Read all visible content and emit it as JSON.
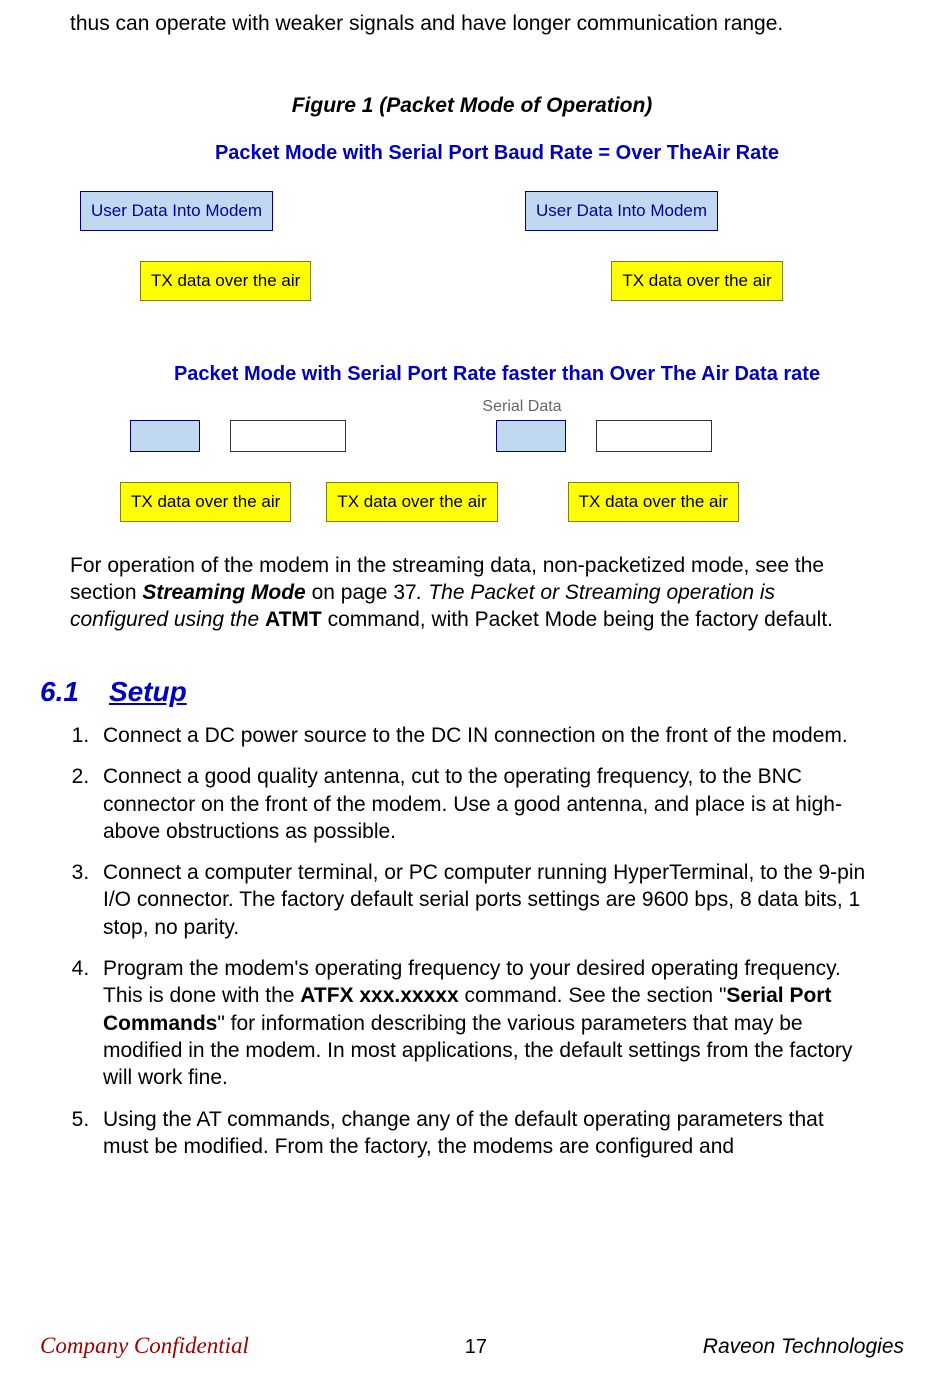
{
  "intro_text": "thus can operate with weaker signals and have longer communication range.",
  "figure": {
    "caption": "Figure 1 (Packet Mode of Operation)",
    "title1": "Packet Mode with Serial Port Baud Rate  =  Over TheAir Rate",
    "user_data_label": "User Data Into Modem",
    "tx_label": "TX data over the air",
    "title2": "Packet Mode with Serial Port Rate faster than Over The Air Data rate",
    "serial_data_label": "Serial Data"
  },
  "after_figure": {
    "prefix": "For operation of the modem in the streaming data, non-packetized mode, see the section ",
    "streaming_mode": "Streaming Mode",
    "mid1": " on page 37",
    "mid2": ".   The Packet or Streaming operation is configured using the ",
    "atmt": "ATMT",
    "suffix": " command, with Packet Mode being the factory default."
  },
  "section": {
    "num": "6.1",
    "title": "Setup"
  },
  "list": {
    "item1": "Connect a DC power source to the DC IN connection on the front of the modem.",
    "item2": "Connect a good quality antenna, cut to the operating frequency, to the BNC connector on the front of the modem.  Use a good antenna, and place is at high-above obstructions as possible.",
    "item3": "Connect a computer terminal, or PC computer running HyperTerminal, to the 9-pin I/O connector.  The factory default serial ports settings are 9600 bps, 8 data bits, 1 stop, no parity.",
    "item4_p1": "Program the modem's operating frequency to your desired operating frequency.  This is done with the ",
    "item4_cmd": "ATFX xxx.xxxxx",
    "item4_p2": " command. See the section \"",
    "item4_section": "Serial Port Commands",
    "item4_p3": "\" for information describing the various parameters that may be modified in the modem.  In most applications, the default settings from the factory will work fine.",
    "item5": "Using the AT commands, change any of the default operating parameters that must be modified.  From the factory, the modems are configured and"
  },
  "footer": {
    "left": "Company Confidential",
    "center": "17",
    "right": "Raveon Technologies"
  }
}
